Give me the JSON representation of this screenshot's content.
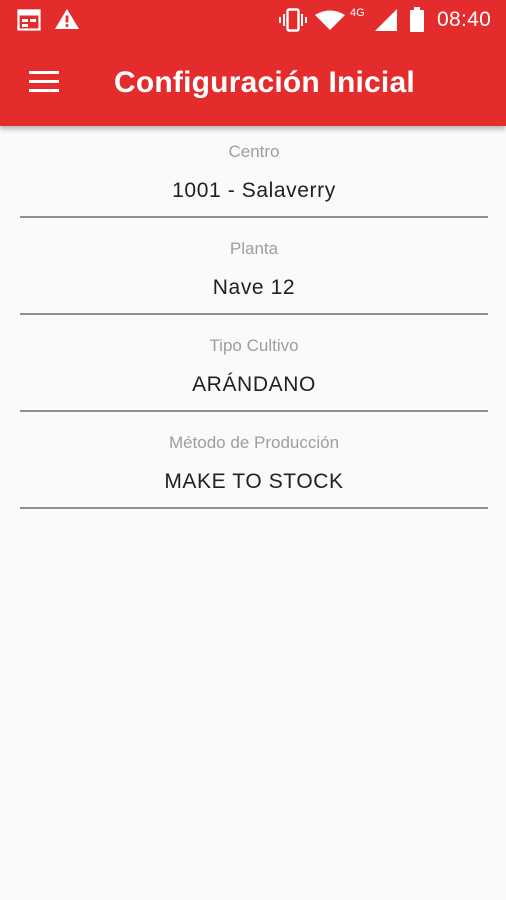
{
  "status_bar": {
    "time": "08:40",
    "network_label": "4G",
    "icons": [
      "calendar-icon",
      "warning-icon",
      "vibrate-icon",
      "wifi-icon",
      "signal-icon",
      "battery-icon"
    ]
  },
  "app_bar": {
    "title": "Configuración Inicial",
    "menu_icon": "menu-icon"
  },
  "fields": [
    {
      "label": "Centro",
      "value": "1001 - Salaverry"
    },
    {
      "label": "Planta",
      "value": "Nave 12"
    },
    {
      "label": "Tipo Cultivo",
      "value": "ARÁNDANO"
    },
    {
      "label": "Método de Producción",
      "value": "MAKE TO STOCK"
    }
  ],
  "colors": {
    "primary": "#e52c2c",
    "background": "#fafafa",
    "label": "#9e9e9e",
    "value": "#212121",
    "underline": "#8f8f8f"
  }
}
